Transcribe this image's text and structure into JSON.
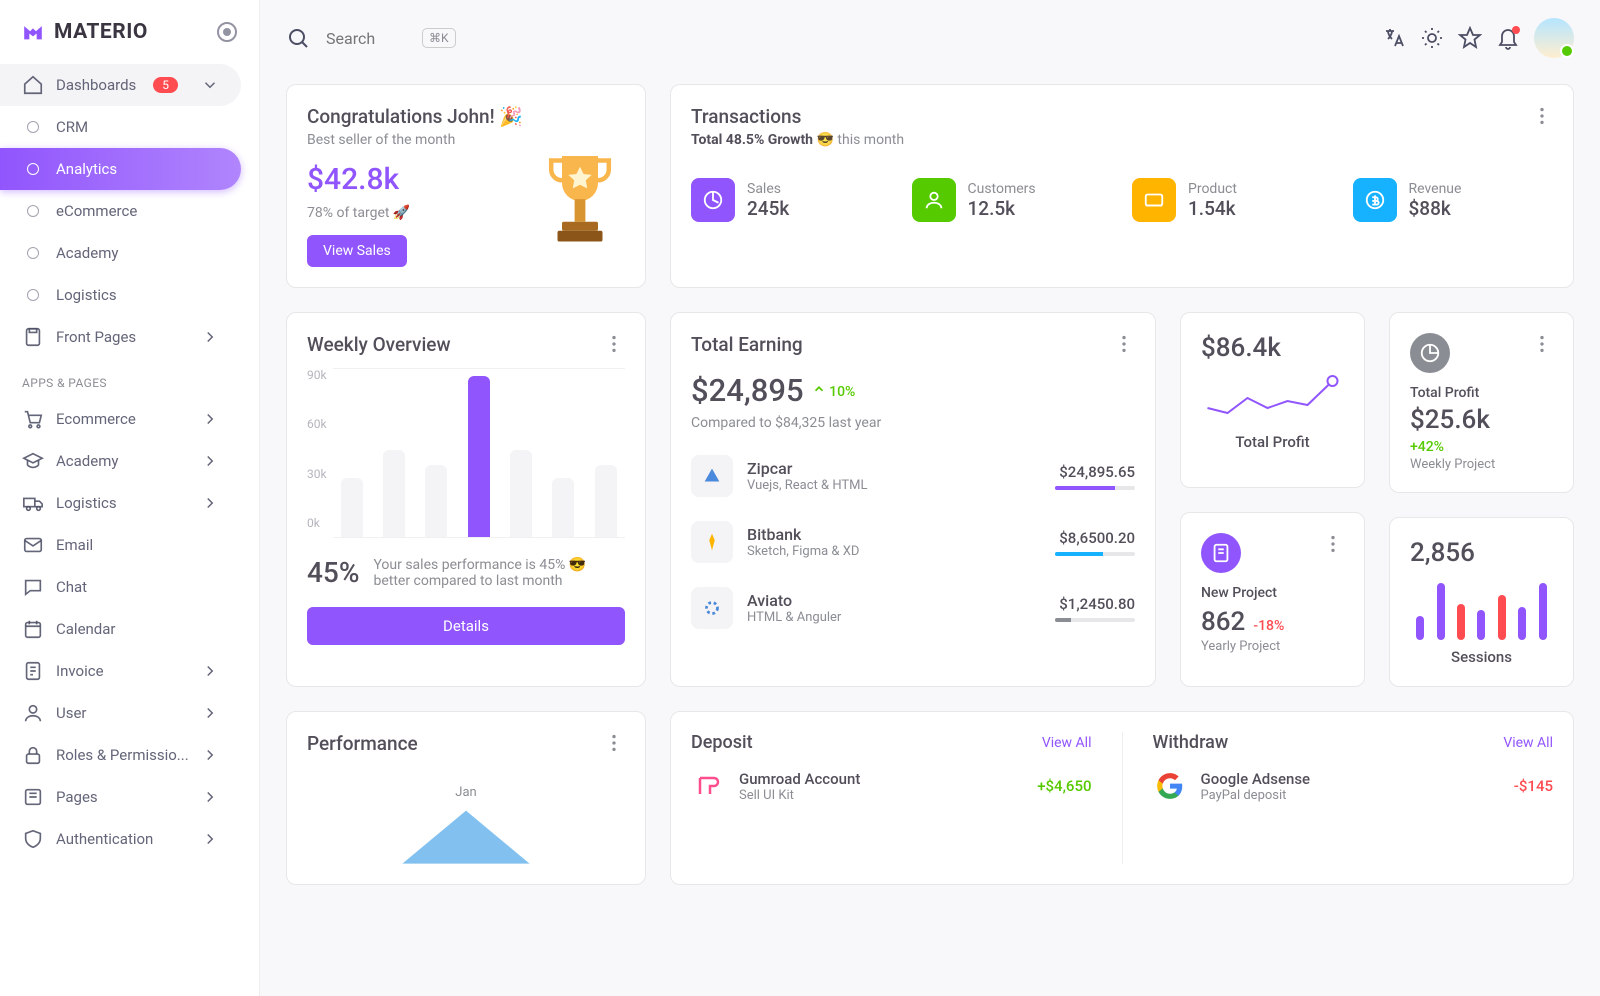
{
  "brand": "MATERIO",
  "sidebar": {
    "dashboards_label": "Dashboards",
    "dashboards_badge": "5",
    "items": [
      "CRM",
      "Analytics",
      "eCommerce",
      "Academy",
      "Logistics"
    ],
    "front_pages": "Front Pages",
    "section_title": "APPS & PAGES",
    "apps": [
      "Ecommerce",
      "Academy",
      "Logistics",
      "Email",
      "Chat",
      "Calendar",
      "Invoice",
      "User",
      "Roles & Permissio...",
      "Pages",
      "Authentication"
    ]
  },
  "topbar": {
    "search_placeholder": "Search",
    "kbd": "⌘K"
  },
  "congrats": {
    "title": "Congratulations John! 🎉",
    "subtitle": "Best seller of the month",
    "amount": "$42.8k",
    "target": "78% of target 🚀",
    "button": "View Sales"
  },
  "transactions": {
    "title": "Transactions",
    "subtitle_prefix": "Total 48.5% Growth 😎",
    "subtitle_suffix": " this month",
    "items": [
      {
        "label": "Sales",
        "value": "245k",
        "color": "#9155fd"
      },
      {
        "label": "Customers",
        "value": "12.5k",
        "color": "#56ca00"
      },
      {
        "label": "Product",
        "value": "1.54k",
        "color": "#ffb400"
      },
      {
        "label": "Revenue",
        "value": "$88k",
        "color": "#16b1ff"
      }
    ]
  },
  "weekly": {
    "title": "Weekly Overview",
    "pct": "45%",
    "text": "Your sales performance is 45% 😎 better compared to last month",
    "button": "Details"
  },
  "earning": {
    "title": "Total Earning",
    "amount": "$24,895",
    "delta": "10%",
    "compare": "Compared to $84,325 last year",
    "items": [
      {
        "name": "Zipcar",
        "desc": "Vuejs, React & HTML",
        "val": "$24,895.65",
        "color": "#9155fd",
        "pct": 75
      },
      {
        "name": "Bitbank",
        "desc": "Sketch, Figma & XD",
        "val": "$8,6500.20",
        "color": "#16b1ff",
        "pct": 60
      },
      {
        "name": "Aviato",
        "desc": "HTML & Anguler",
        "val": "$1,2450.80",
        "color": "#8a8d93",
        "pct": 20
      }
    ]
  },
  "small1": {
    "amount": "$86.4k",
    "title": "Total Profit"
  },
  "small2": {
    "title": "Total Profit",
    "amount": "$25.6k",
    "delta": "+42%",
    "sub": "Weekly Project"
  },
  "small3": {
    "title": "New Project",
    "amount": "862",
    "delta": "-18%",
    "sub": "Yearly Project"
  },
  "small4": {
    "amount": "2,856",
    "title": "Sessions"
  },
  "performance": {
    "title": "Performance",
    "month": "Jan"
  },
  "deposit": {
    "title": "Deposit",
    "view_all": "View All",
    "item": {
      "name": "Gumroad Account",
      "desc": "Sell UI Kit",
      "amt": "+$4,650"
    }
  },
  "withdraw": {
    "title": "Withdraw",
    "view_all": "View All",
    "item": {
      "name": "Google Adsense",
      "desc": "PayPal deposit",
      "amt": "-$145"
    }
  },
  "chart_data": {
    "type": "bar",
    "ylabel": "",
    "ylim": [
      0,
      90
    ],
    "yticks": [
      "90k",
      "60k",
      "30k",
      "0k"
    ],
    "values": [
      32,
      48,
      40,
      88,
      48,
      32,
      40
    ],
    "highlight_index": 3,
    "colors": {
      "default": "#f4f3f6",
      "highlight": "#9155fd"
    }
  }
}
